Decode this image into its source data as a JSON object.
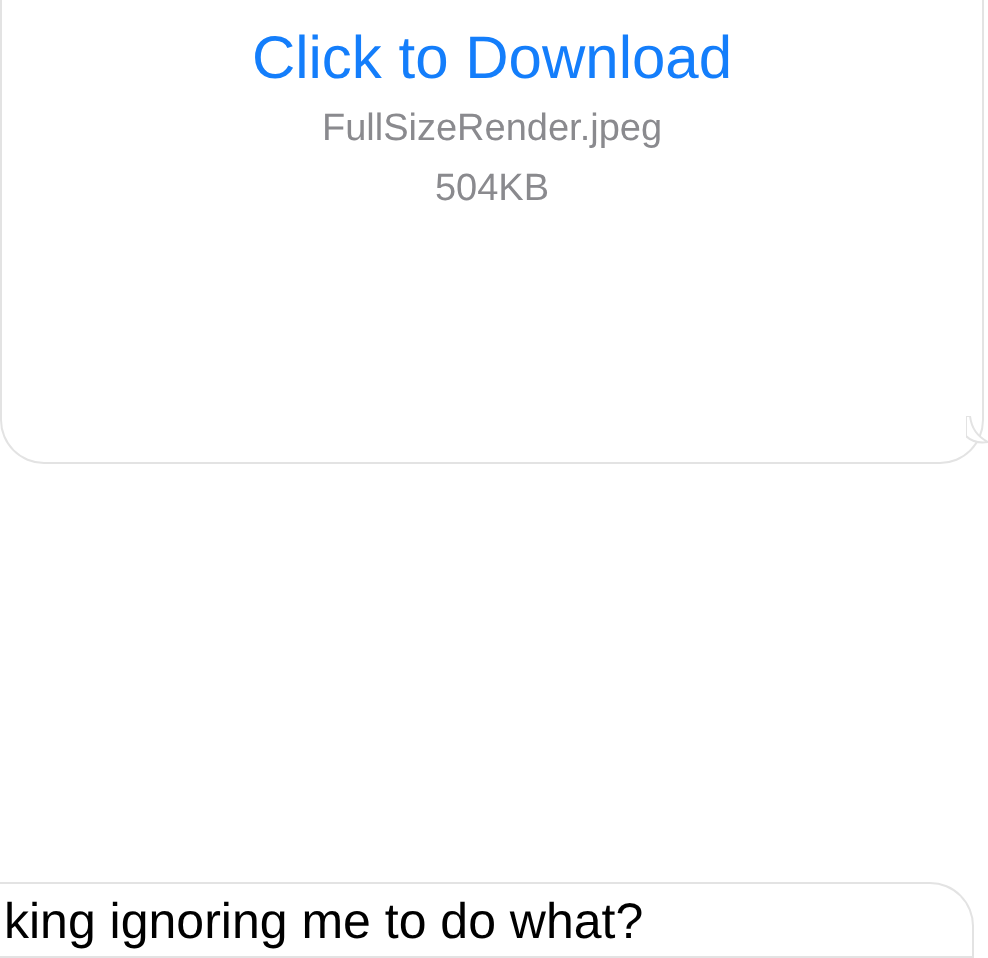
{
  "messages": [
    {
      "kind": "attachment",
      "link": "Click to Download",
      "filename": "FullSizeRender.jpeg",
      "size": "504KB"
    },
    {
      "kind": "text",
      "text": "king ignoring me to do what?"
    }
  ]
}
